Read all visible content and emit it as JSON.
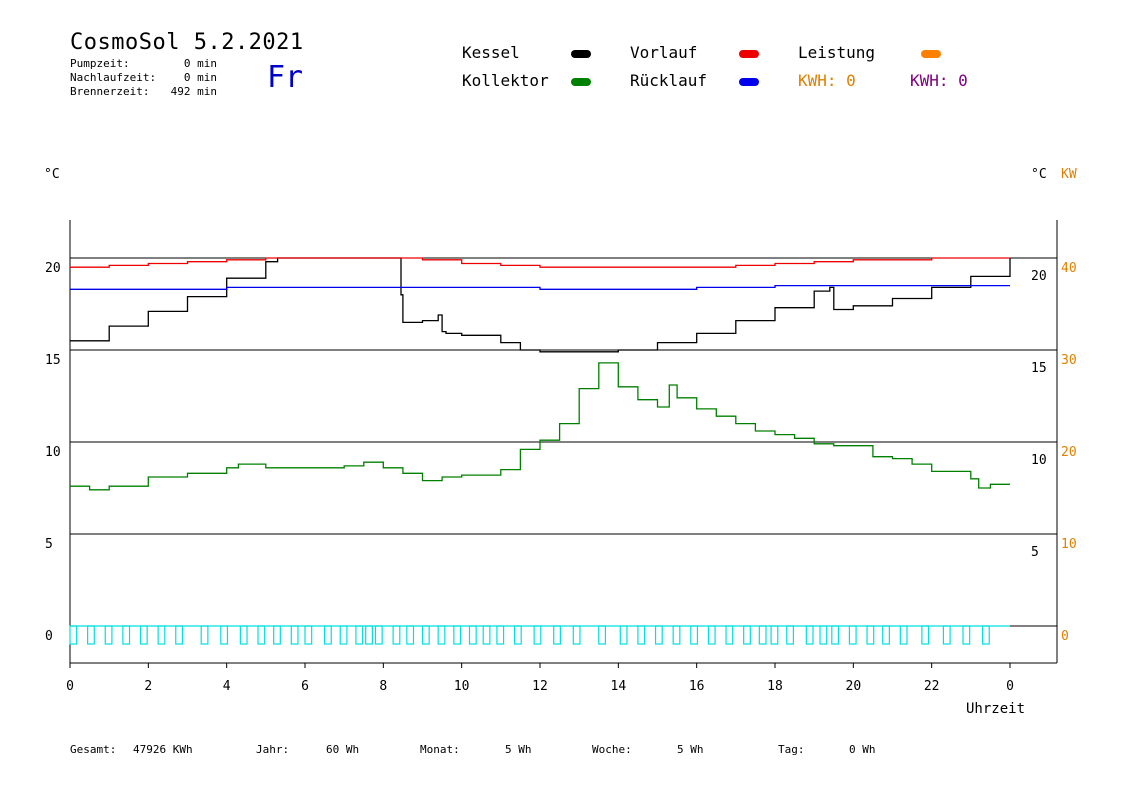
{
  "header": {
    "title": "CosmoSol 5.2.2021",
    "day": "Fr",
    "stats": [
      {
        "label": "Pumpzeit:",
        "value": "0 min"
      },
      {
        "label": "Nachlaufzeit:",
        "value": "0 min"
      },
      {
        "label": "Brennerzeit:",
        "value": "492 min"
      }
    ]
  },
  "legend": {
    "kessel": {
      "label": "Kessel",
      "color": "#000000"
    },
    "kollektor": {
      "label": "Kollektor",
      "color": "#008000"
    },
    "vorlauf": {
      "label": "Vorlauf",
      "color": "#ee0000"
    },
    "ruecklauf": {
      "label": "Rücklauf",
      "color": "#0000ee"
    },
    "leistung": {
      "label": "Leistung",
      "color": "#ff8000"
    },
    "kwh_orange": {
      "label": "KWH: 0",
      "color": "#ff8000"
    },
    "kwh_purple": {
      "label": "KWH: 0",
      "color": "#800080"
    }
  },
  "axes": {
    "left_unit": "°C",
    "right_unit": "°C",
    "right_unit2": "KW",
    "xlabel": "Uhrzeit",
    "left_ticks": [
      "20",
      "15",
      "10",
      "5",
      "0"
    ],
    "inner_ticks": [
      "20",
      "15",
      "10",
      "5"
    ],
    "right_ticks": [
      "40",
      "30",
      "20",
      "10",
      "0"
    ],
    "x_ticks": [
      "0",
      "2",
      "4",
      "6",
      "8",
      "10",
      "12",
      "14",
      "16",
      "18",
      "20",
      "22",
      "0"
    ]
  },
  "footer": [
    {
      "label": "Gesamt:",
      "value": "47926 KWh"
    },
    {
      "label": "Jahr:",
      "value": "60 Wh"
    },
    {
      "label": "Monat:",
      "value": "5 Wh"
    },
    {
      "label": "Woche:",
      "value": "5 Wh"
    },
    {
      "label": "Tag:",
      "value": "0 Wh"
    }
  ],
  "chart_data": {
    "type": "line",
    "xlabel": "Uhrzeit",
    "ylabel": "°C",
    "xlim": [
      0,
      24
    ],
    "ylim": [
      0,
      20
    ],
    "grid": true,
    "series": [
      {
        "name": "Kessel",
        "color": "#000000",
        "x": [
          0,
          1,
          2,
          3,
          4,
          5,
          5.3,
          6,
          7,
          8,
          8.4,
          8.45,
          8.5,
          9,
          9.4,
          9.5,
          9.6,
          10,
          11,
          11.5,
          12,
          13,
          14,
          15,
          16,
          17,
          18,
          19,
          19.4,
          19.5,
          20,
          21,
          22,
          23,
          24
        ],
        "y": [
          15.5,
          16.3,
          17.1,
          17.9,
          18.9,
          19.8,
          20,
          20,
          20,
          20,
          20,
          18,
          16.5,
          16.6,
          16.9,
          16,
          15.9,
          15.8,
          15.4,
          15,
          14.9,
          14.9,
          15,
          15.4,
          15.9,
          16.6,
          17.3,
          18.2,
          18.4,
          17.2,
          17.4,
          17.8,
          18.4,
          19,
          20
        ]
      },
      {
        "name": "Kollektor",
        "color": "#008000",
        "x": [
          0,
          0.5,
          1,
          2,
          3,
          4,
          4.3,
          5,
          6,
          7,
          7.5,
          8,
          8.5,
          9,
          9.5,
          10,
          10.5,
          11,
          11.5,
          12,
          12.5,
          13,
          13.5,
          14,
          14.5,
          15,
          15.3,
          15.5,
          16,
          16.5,
          17,
          17.5,
          18,
          18.5,
          19,
          19.5,
          20,
          20.5,
          21,
          21.5,
          22,
          22.5,
          23,
          23.2,
          23.5,
          24
        ],
        "y": [
          7.6,
          7.4,
          7.6,
          8.1,
          8.3,
          8.6,
          8.8,
          8.6,
          8.6,
          8.7,
          8.9,
          8.6,
          8.3,
          7.9,
          8.1,
          8.2,
          8.2,
          8.5,
          9.6,
          10.1,
          11,
          12.9,
          14.3,
          13,
          12.3,
          11.9,
          13.1,
          12.4,
          11.8,
          11.4,
          11,
          10.6,
          10.4,
          10.2,
          9.9,
          9.8,
          9.8,
          9.2,
          9.1,
          8.8,
          8.4,
          8.4,
          8,
          7.5,
          7.7,
          7.7
        ]
      },
      {
        "name": "Vorlauf",
        "color": "#ee0000",
        "x": [
          0,
          1,
          2,
          3,
          4,
          5,
          6,
          7,
          8,
          9,
          10,
          11,
          12,
          13,
          14,
          15,
          16,
          17,
          18,
          19,
          20,
          21,
          22,
          23,
          24
        ],
        "y": [
          19.5,
          19.6,
          19.7,
          19.8,
          19.9,
          20,
          20,
          20,
          20,
          19.9,
          19.7,
          19.6,
          19.5,
          19.5,
          19.5,
          19.5,
          19.5,
          19.6,
          19.7,
          19.8,
          19.9,
          19.9,
          20,
          20,
          20
        ]
      },
      {
        "name": "Rücklauf",
        "color": "#0000ee",
        "x": [
          0,
          2,
          4,
          6,
          8,
          10,
          12,
          14,
          16,
          18,
          20,
          22,
          24
        ],
        "y": [
          18.3,
          18.3,
          18.4,
          18.4,
          18.4,
          18.4,
          18.3,
          18.3,
          18.4,
          18.5,
          18.5,
          18.5,
          18.5
        ]
      }
    ],
    "pump_pulses": {
      "name": "Leistung",
      "color": "#00e0e0",
      "level_kw": 0,
      "starts_h": [
        0,
        0.45,
        0.9,
        1.35,
        1.8,
        2.25,
        2.7,
        3.35,
        3.85,
        4.35,
        4.8,
        5.2,
        5.65,
        6,
        6.5,
        6.9,
        7.3,
        7.55,
        7.8,
        8.25,
        8.6,
        9,
        9.4,
        9.8,
        10.2,
        10.55,
        10.9,
        11.35,
        11.85,
        12.35,
        12.85,
        13.5,
        14.05,
        14.5,
        14.95,
        15.4,
        15.85,
        16.3,
        16.75,
        17.2,
        17.6,
        17.9,
        18.3,
        18.8,
        19.15,
        19.45,
        19.9,
        20.35,
        20.75,
        21.2,
        21.75,
        22.3,
        22.8,
        23.3
      ],
      "width_h": 0.17
    }
  }
}
